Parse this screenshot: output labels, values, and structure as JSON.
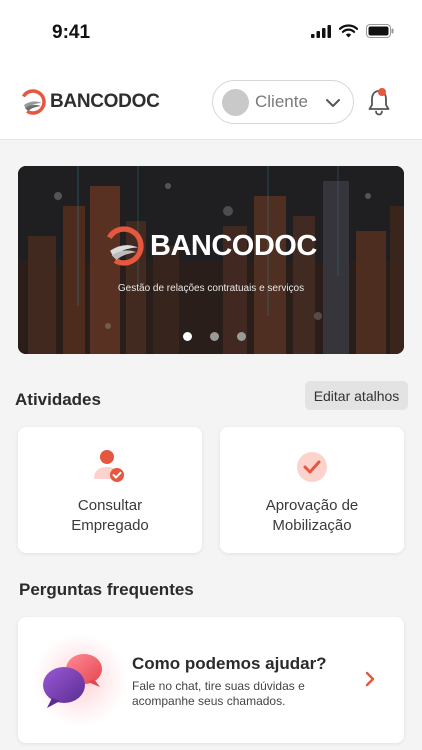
{
  "status_bar": {
    "time": "9:41"
  },
  "header": {
    "brand": "BANCODOC",
    "profile_select": "Cliente"
  },
  "banner": {
    "brand": "BANCODOC",
    "tagline": "Gestão de relações contratuais e serviços",
    "slides": 3,
    "active_slide": 0
  },
  "activities": {
    "title": "Atividades",
    "edit_label": "Editar atalhos",
    "items": [
      {
        "line1": "Consultar",
        "line2": "Empregado",
        "icon": "user-check-icon"
      },
      {
        "line1": "Aprovação de",
        "line2": "Mobilização",
        "icon": "check-circle-icon"
      }
    ]
  },
  "faq": {
    "title": "Perguntas frequentes",
    "card_title": "Como podemos ajudar?",
    "card_desc": "Fale no chat, tire suas dúvidas e acompanhe seus chamados.",
    "icon": "chat-bubbles-icon"
  },
  "colors": {
    "accent": "#e5573f",
    "accent_light": "#fde3df",
    "background": "#f4f4f4"
  }
}
